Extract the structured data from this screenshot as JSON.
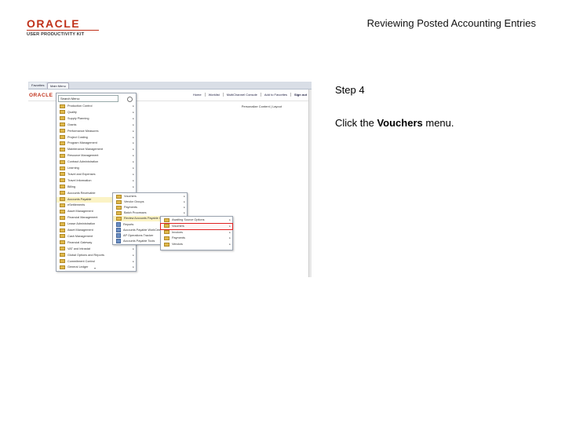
{
  "header": {
    "logo_main": "ORACLE",
    "logo_sub": "USER PRODUCTIVITY KIT",
    "title": "Reviewing Posted Accounting Entries"
  },
  "instruction": {
    "step": "Step 4",
    "text_before": "Click the ",
    "target": "Vouchers",
    "text_after": " menu."
  },
  "screenshot": {
    "tabs": [
      "Favorites",
      "Main Menu"
    ],
    "oracle": "ORACLE",
    "header_links": [
      "Home",
      "Worklist",
      "MultiChannel Console",
      "Add to Favorites",
      "Sign out"
    ],
    "personalize": "Personalize Content | Layout",
    "search_label": "Search Menu:",
    "main_menu": [
      "Production Control",
      "Quality",
      "Supply Planning",
      "Grants",
      "Performance Measures",
      "Project Costing",
      "Program Management",
      "Maintenance Management",
      "Resource Management",
      "Contract Administration",
      "Learning",
      "Travel and Expenses",
      "Travel Information",
      "Billing",
      "Accounts Receivable",
      "Accounts Payable",
      "eSettlements",
      "Asset Management",
      "Financial Management",
      "Lease Administration",
      "Asset Management",
      "Cash Management",
      "Financial Gateway",
      "VAT and Intrastat",
      "Global Options and Reports",
      "Commitment Control",
      "General Ledger"
    ],
    "ap_menu": [
      "Vouchers",
      "Vendor Groups",
      "Payments",
      "Batch Processes",
      "Review Accounts Payable Info",
      "Reports",
      "Accounts Payable WorkCenter",
      "AP Operations Tracker",
      "Accounts Payable Tools"
    ],
    "review_menu": [
      "Awaiting Source Options",
      "Vouchers",
      "Invoices",
      "Payments",
      "Vendors"
    ]
  }
}
